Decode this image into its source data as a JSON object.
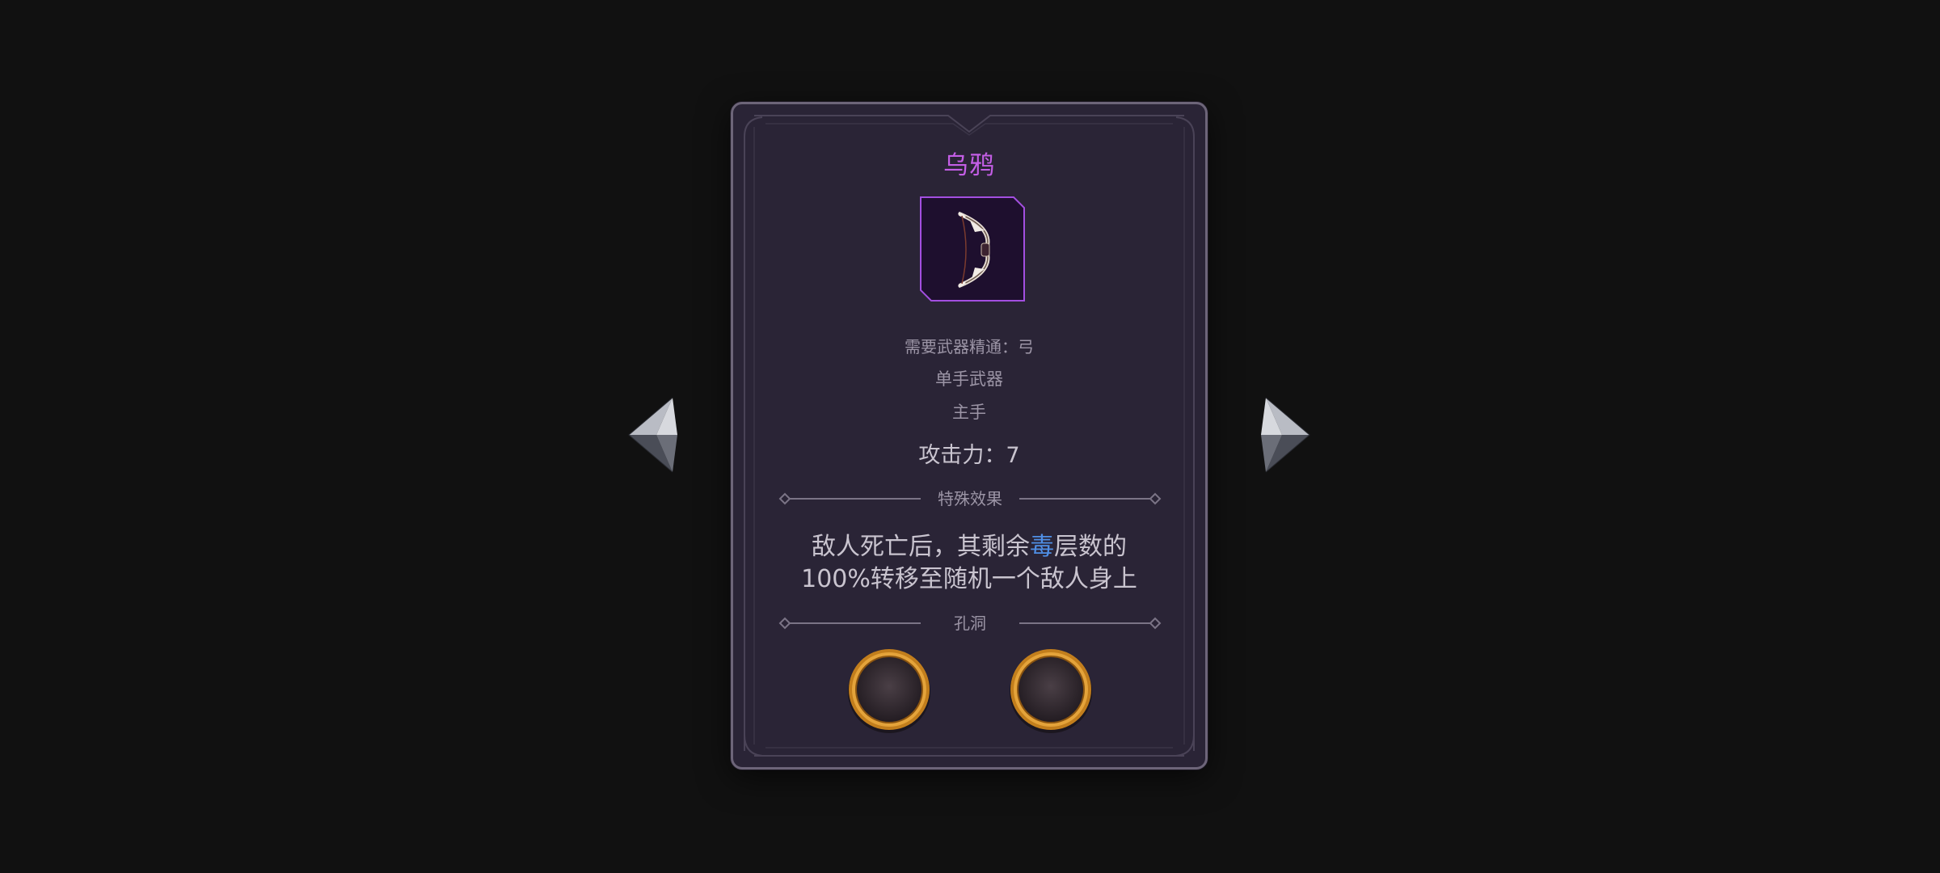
{
  "item": {
    "name": "乌鸦",
    "icon": "bow-icon",
    "requirement": "需要武器精通：弓",
    "hand_type": "单手武器",
    "slot": "主手",
    "attack": "攻击力：7",
    "rarity_color": "#c45ee6"
  },
  "effects": {
    "header": "特殊效果",
    "line1_before": "敌人死亡后，其剩余",
    "line1_keyword": "毒",
    "line1_after": "层数的",
    "line2": "100%转移至随机一个敌人身上",
    "keyword_color": "#4f8fe6"
  },
  "sockets": {
    "header": "孔洞",
    "count": 2
  },
  "navigation": {
    "previous_icon": "arrow-left-icon",
    "next_icon": "arrow-right-icon"
  }
}
